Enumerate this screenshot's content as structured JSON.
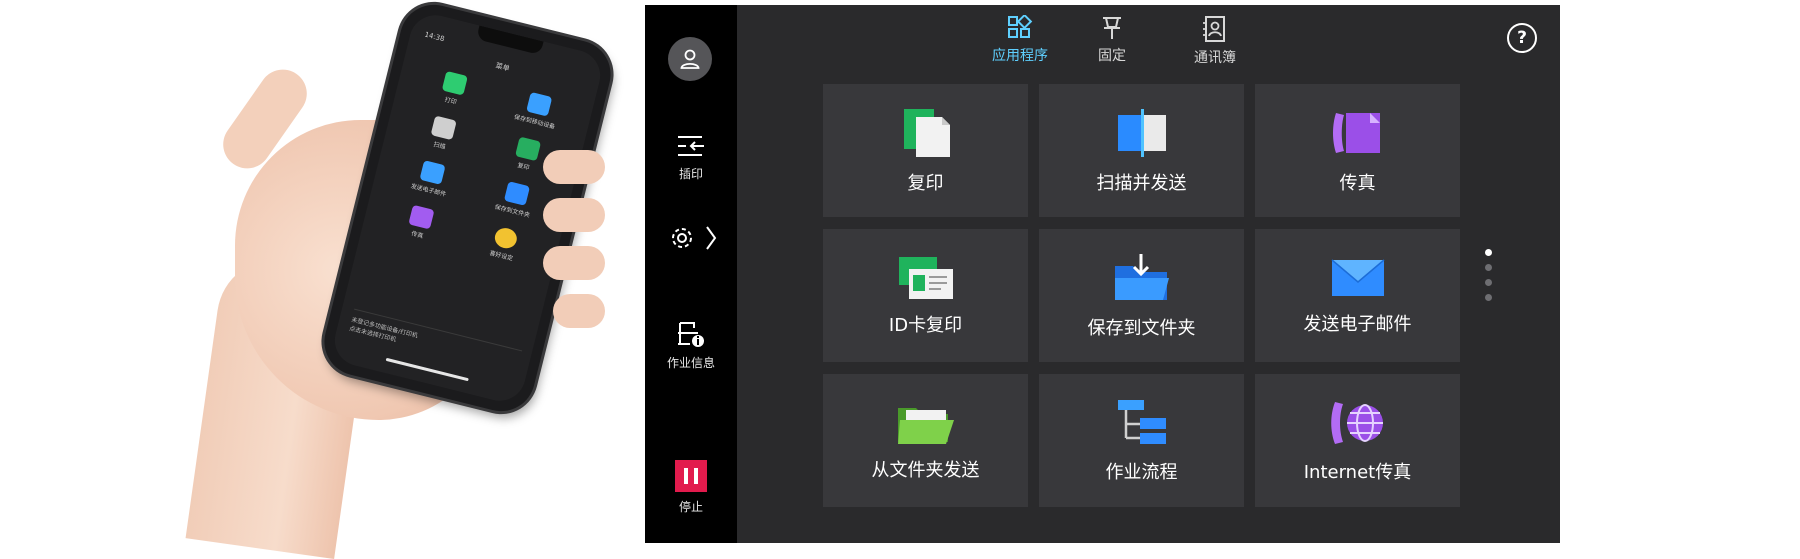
{
  "phone": {
    "time": "14:38",
    "title": "菜单",
    "items": [
      {
        "label": "打印",
        "icon": "print-icon",
        "color": "#2ecc71"
      },
      {
        "label": "保存到移动设备",
        "icon": "save-to-mobile-icon",
        "color": "#3aa0ff"
      },
      {
        "label": "扫描",
        "icon": "scan-icon",
        "color": "#cfcfcf"
      },
      {
        "label": "复印",
        "icon": "copy-icon",
        "color": "#27ae60"
      },
      {
        "label": "发送电子邮件",
        "icon": "email-icon",
        "color": "#3aa0ff"
      },
      {
        "label": "保存到文件夹",
        "icon": "folder-icon",
        "color": "#2f8cff"
      },
      {
        "label": "传真",
        "icon": "fax-icon",
        "color": "#a25cf0"
      },
      {
        "label": "喜好设定",
        "icon": "star-icon",
        "color": "#f2c230"
      }
    ],
    "footer_line1": "未登记多功能设备/打印机",
    "footer_line2": "点击未选择打印机"
  },
  "sidebar": {
    "interrupt_label": "插印",
    "job_info_label": "作业信息",
    "stop_label": "停止"
  },
  "topnav": [
    {
      "label": "应用程序",
      "active": true
    },
    {
      "label": "固定",
      "active": false
    },
    {
      "label": "通讯簿",
      "active": false
    }
  ],
  "tiles": [
    {
      "label": "复印"
    },
    {
      "label": "扫描并发送"
    },
    {
      "label": "传真"
    },
    {
      "label": "ID卡复印"
    },
    {
      "label": "保存到文件夹"
    },
    {
      "label": "发送电子邮件"
    },
    {
      "label": "从文件夹发送"
    },
    {
      "label": "作业流程"
    },
    {
      "label": "Internet传真"
    }
  ],
  "colors": {
    "accent": "#5fd0ff",
    "stop": "#e21b4d",
    "tile_bg": "#38383b",
    "panel_bg": "#2a2a2c"
  },
  "pagination": {
    "pages": 4,
    "current": 1
  }
}
